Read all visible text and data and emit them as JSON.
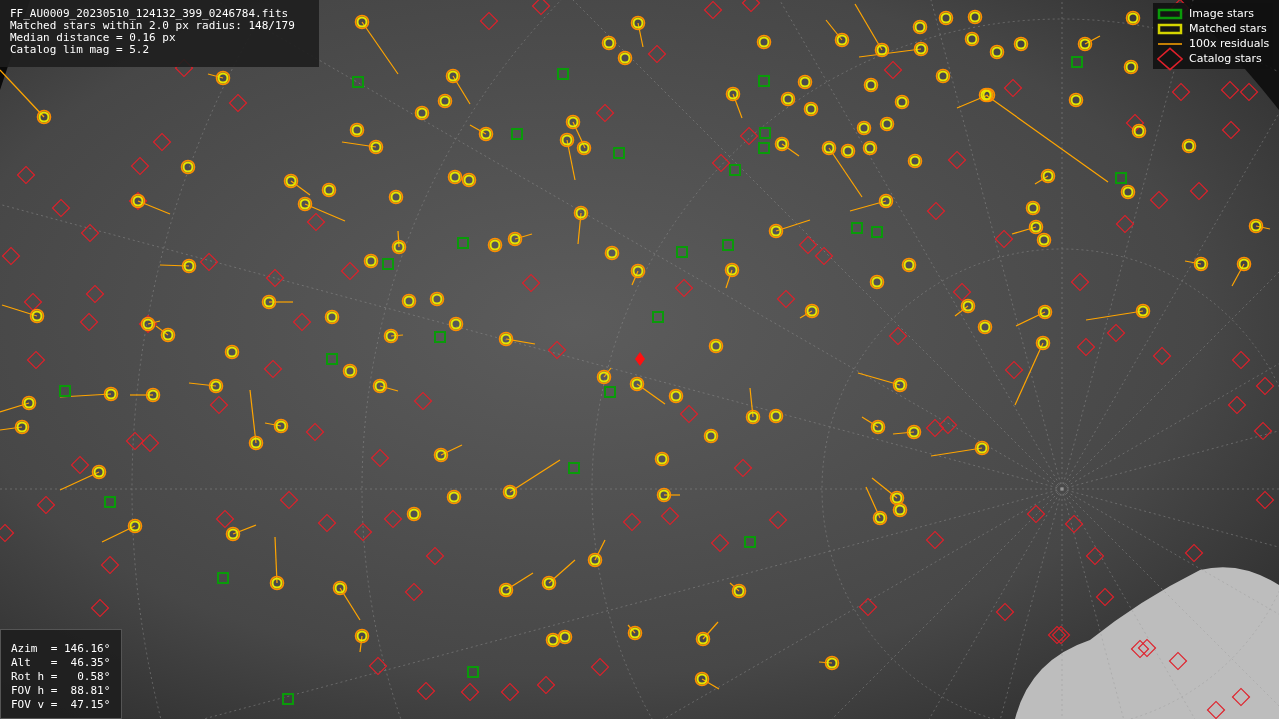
{
  "file_info": {
    "lines": [
      "FF_AU0009_20230510_124132_399_0246784.fits",
      "Matched stars within 2.0 px radius: 148/179",
      "Median distance = 0.16 px",
      "Catalog lim mag = 5.2"
    ]
  },
  "legend": [
    {
      "kind": "image",
      "label": "Image stars"
    },
    {
      "kind": "matched",
      "label": "Matched stars"
    },
    {
      "kind": "residual",
      "label": "100x residuals"
    },
    {
      "kind": "catalog",
      "label": "Catalog stars"
    }
  ],
  "pointing": {
    "lines": [
      "Azim  = 146.16°",
      "Alt   =  46.35°",
      "Rot h =   0.58°",
      "FOV h =  88.81°",
      "FOV v =  47.15°"
    ]
  }
}
